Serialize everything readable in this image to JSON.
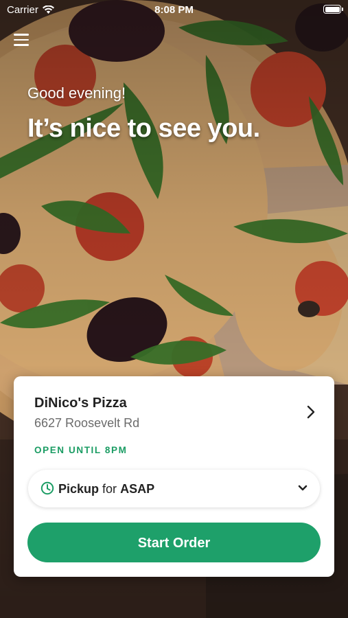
{
  "status_bar": {
    "carrier": "Carrier",
    "time": "8:08 PM",
    "icons": [
      "wifi-icon",
      "battery-icon"
    ]
  },
  "header": {
    "menu_icon": "hamburger-menu-icon"
  },
  "greeting": {
    "salutation": "Good evening!",
    "headline": "It’s nice to see you."
  },
  "location": {
    "name": "DiNico's Pizza",
    "address": "6627 Roosevelt Rd",
    "hours": "OPEN UNTIL 8PM",
    "icon": "chevron-right-icon"
  },
  "order_mode": {
    "method": "Pickup",
    "connector": "for",
    "timing": "ASAP",
    "icons": [
      "clock-icon",
      "chevron-down-icon"
    ]
  },
  "actions": {
    "start_order_label": "Start Order"
  },
  "colors": {
    "accent": "#1ea06a",
    "hours_text": "#1a9c63",
    "card": "#ffffff"
  }
}
